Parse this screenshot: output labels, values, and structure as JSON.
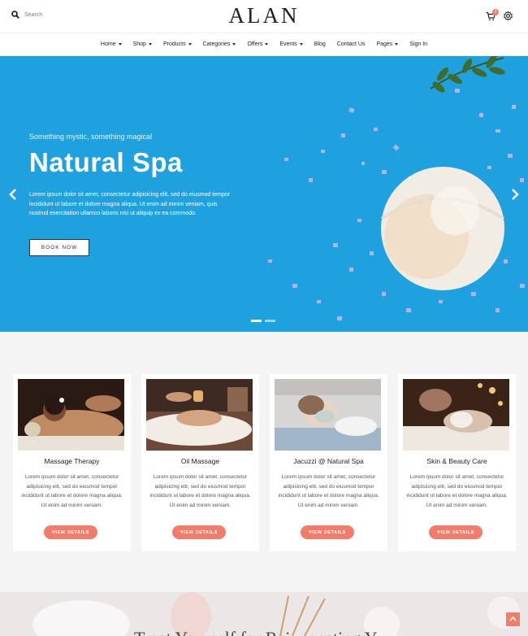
{
  "header": {
    "search_placeholder": "Search",
    "logo": "ALAN",
    "cart_count": "0"
  },
  "nav": [
    {
      "label": "Home",
      "dropdown": true
    },
    {
      "label": "Shop",
      "dropdown": true
    },
    {
      "label": "Products",
      "dropdown": true
    },
    {
      "label": "Categories",
      "dropdown": true
    },
    {
      "label": "Offers",
      "dropdown": true
    },
    {
      "label": "Events",
      "dropdown": true
    },
    {
      "label": "Blog",
      "dropdown": false
    },
    {
      "label": "Contact Us",
      "dropdown": false
    },
    {
      "label": "Pages",
      "dropdown": true
    },
    {
      "label": "Sign In",
      "dropdown": false
    }
  ],
  "hero": {
    "eyebrow": "Something mystic, something magical",
    "title": "Natural Spa",
    "text": "Lorem ipsum dolor sit amet, consectetur adipisicing elit, sed do eiusmod tempor incididunt ut labore et dolore magna aliqua. Ut enim ad minim veniam, quis nostrud exercitation ullamco laboris nisi ut aliquip ex ea commodo.",
    "button": "BOOK NOW",
    "bg_color": "#1ea1de",
    "slides": 2,
    "active_slide": 1
  },
  "services": [
    {
      "title": "Massage Therapy",
      "text": "Lorem ipsum dolor sit amet, consectetur adipisicing elit, sed do eiusmod tempor incididunt ut labore et dolore magna aliqua. Ut enim ad minim veniam.",
      "button": "VIEW DETAILS"
    },
    {
      "title": "Oil Massage",
      "text": "Lorem ipsum dolor sit amet, consectetur adipisicing elit, sed do eiusmod tempor incididunt ut labore et dolore magna aliqua. Ut enim ad minim veniam.",
      "button": "VIEW DETAILS"
    },
    {
      "title": "Jacuzzi @ Natural Spa",
      "text": "Lorem ipsum dolor sit amet, consectetur adipisicing elit, sed do eiusmod tempor incididunt ut labore et dolore magna aliqua. Ut enim ad minim veniam.",
      "button": "VIEW DETAILS"
    },
    {
      "title": "Skin & Beauty Care",
      "text": "Lorem ipsum dolor sit amet, consectetur adipisicing elit, sed do eiusmod tempor incididunt ut labore et dolore magna aliqua. Ut enim ad minim veniam.",
      "button": "VIEW DETAILS"
    }
  ],
  "bottom": {
    "heading_partial": "Treat Yourself for Rejuvenating Y"
  },
  "colors": {
    "accent": "#f07c6c",
    "hero_blue": "#1ea1de",
    "section_bg": "#f4f4f4"
  },
  "icons": [
    "search-icon",
    "cart-icon",
    "gear-icon",
    "chevron-left-icon",
    "chevron-right-icon",
    "arrow-up-icon"
  ]
}
